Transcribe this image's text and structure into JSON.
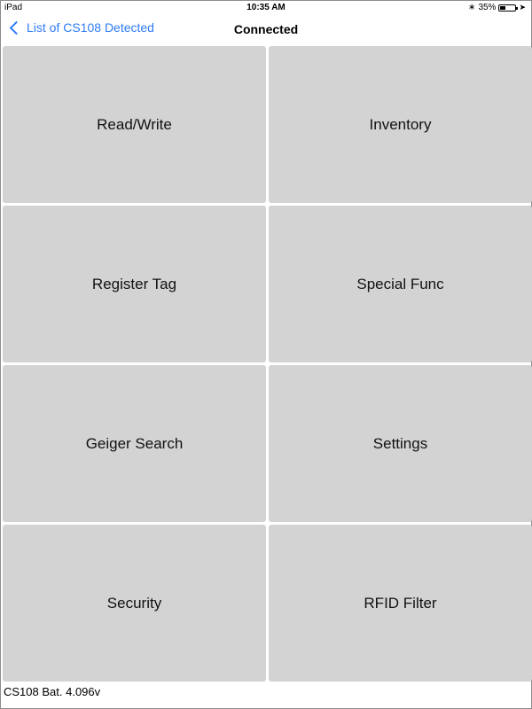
{
  "status_bar": {
    "device": "iPad",
    "time": "10:35 AM",
    "battery_percent_label": "35%",
    "battery_level": 0.35
  },
  "nav": {
    "back_label": "List of CS108 Detected",
    "title": "Connected"
  },
  "menu": {
    "items": [
      {
        "label": "Read/Write"
      },
      {
        "label": "Inventory"
      },
      {
        "label": "Register Tag"
      },
      {
        "label": "Special Func"
      },
      {
        "label": "Geiger Search"
      },
      {
        "label": "Settings"
      },
      {
        "label": "Security"
      },
      {
        "label": "RFID Filter"
      }
    ]
  },
  "footer": {
    "battery_text": "CS108 Bat. 4.096v"
  },
  "colors": {
    "accent": "#2f7bf5",
    "tile_bg": "#d3d3d3"
  }
}
